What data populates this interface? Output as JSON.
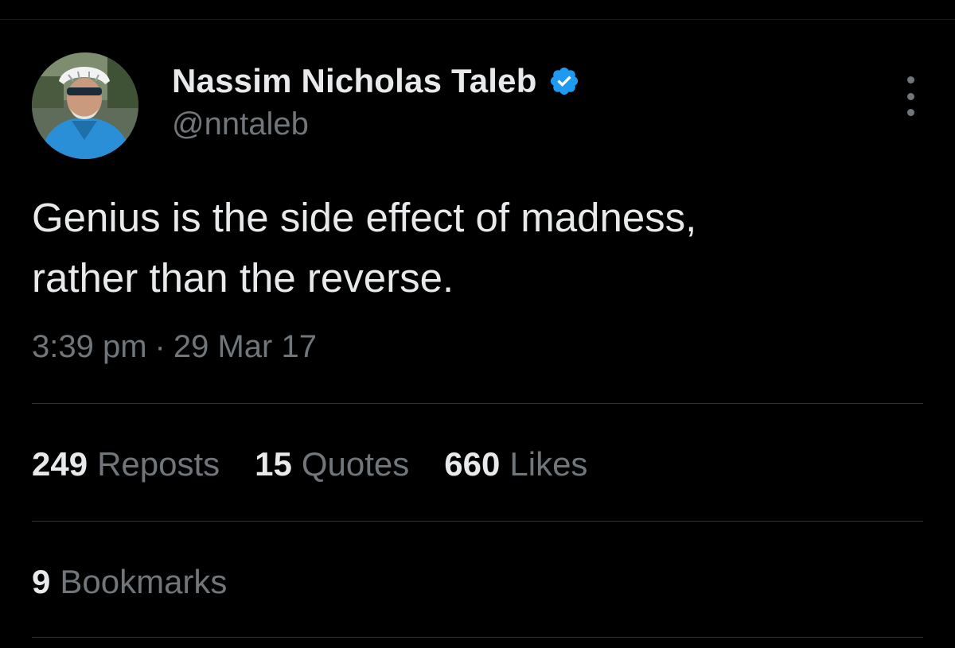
{
  "author": {
    "display_name": "Nassim Nicholas Taleb",
    "handle": "@nntaleb",
    "verified": true,
    "avatar": "cyclist-profile-photo"
  },
  "tweet": {
    "lines": [
      "Genius is the side effect of madness,",
      "rather than the reverse."
    ],
    "time": "3:39 pm",
    "separator": "·",
    "date": "29 Mar 17"
  },
  "stats": {
    "reposts_count": "249",
    "reposts_label": "Reposts",
    "quotes_count": "15",
    "quotes_label": "Quotes",
    "likes_count": "660",
    "likes_label": "Likes",
    "bookmarks_count": "9",
    "bookmarks_label": "Bookmarks"
  },
  "icons": {
    "verified": "verified-badge-icon",
    "more": "more-options-icon"
  },
  "colors": {
    "background": "#000000",
    "primary_text": "#e7e9ea",
    "secondary_text": "#71767b",
    "divider": "#2f3336",
    "verified_blue": "#1d9bf0"
  }
}
